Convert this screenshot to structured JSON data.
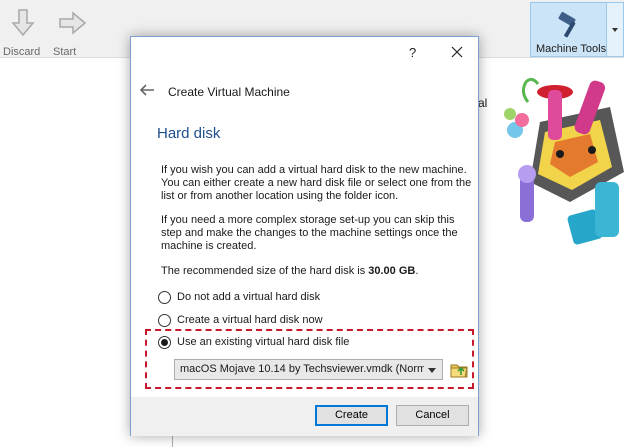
{
  "toolbar": {
    "discard_label": "Discard",
    "start_label": "Start",
    "machine_tools_label": "Machine Tools"
  },
  "background": {
    "peek_text": "al"
  },
  "dialog": {
    "help_label": "?",
    "title": "Create Virtual Machine",
    "section_title": "Hard disk",
    "paragraph1": "If you wish you can add a virtual hard disk to the new machine. You can either create a new hard disk file or select one from the list or from another location using the folder icon.",
    "paragraph2": "If you need a more complex storage set-up you can skip this step and make the changes to the machine settings once the machine is created.",
    "recommended_prefix": "The recommended size of the hard disk is ",
    "recommended_size": "30.00 GB",
    "recommended_suffix": ".",
    "options": [
      {
        "label": "Do not add a virtual hard disk",
        "selected": false
      },
      {
        "label": "Create a virtual hard disk now",
        "selected": false
      },
      {
        "label": "Use an existing virtual hard disk file",
        "selected": true
      }
    ],
    "disk_file_value": "macOS Mojave 10.14 by Techsviewer.vmdk (Norm",
    "create_label": "Create",
    "cancel_label": "Cancel"
  },
  "colors": {
    "accent": "#1e4e8c",
    "highlight_dash": "#c8182b",
    "primary_button_border": "#0078d7"
  }
}
